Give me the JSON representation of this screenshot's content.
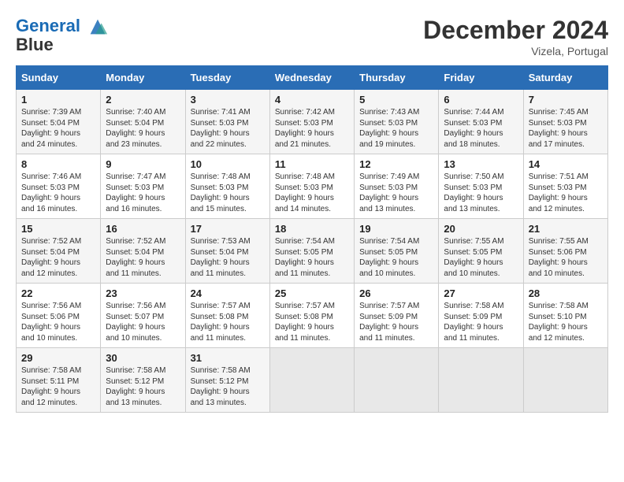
{
  "header": {
    "logo_line1": "General",
    "logo_line2": "Blue",
    "month_title": "December 2024",
    "location": "Vizela, Portugal"
  },
  "weekdays": [
    "Sunday",
    "Monday",
    "Tuesday",
    "Wednesday",
    "Thursday",
    "Friday",
    "Saturday"
  ],
  "weeks": [
    [
      {
        "day": "1",
        "sunrise": "Sunrise: 7:39 AM",
        "sunset": "Sunset: 5:04 PM",
        "daylight": "Daylight: 9 hours and 24 minutes."
      },
      {
        "day": "2",
        "sunrise": "Sunrise: 7:40 AM",
        "sunset": "Sunset: 5:04 PM",
        "daylight": "Daylight: 9 hours and 23 minutes."
      },
      {
        "day": "3",
        "sunrise": "Sunrise: 7:41 AM",
        "sunset": "Sunset: 5:03 PM",
        "daylight": "Daylight: 9 hours and 22 minutes."
      },
      {
        "day": "4",
        "sunrise": "Sunrise: 7:42 AM",
        "sunset": "Sunset: 5:03 PM",
        "daylight": "Daylight: 9 hours and 21 minutes."
      },
      {
        "day": "5",
        "sunrise": "Sunrise: 7:43 AM",
        "sunset": "Sunset: 5:03 PM",
        "daylight": "Daylight: 9 hours and 19 minutes."
      },
      {
        "day": "6",
        "sunrise": "Sunrise: 7:44 AM",
        "sunset": "Sunset: 5:03 PM",
        "daylight": "Daylight: 9 hours and 18 minutes."
      },
      {
        "day": "7",
        "sunrise": "Sunrise: 7:45 AM",
        "sunset": "Sunset: 5:03 PM",
        "daylight": "Daylight: 9 hours and 17 minutes."
      }
    ],
    [
      {
        "day": "8",
        "sunrise": "Sunrise: 7:46 AM",
        "sunset": "Sunset: 5:03 PM",
        "daylight": "Daylight: 9 hours and 16 minutes."
      },
      {
        "day": "9",
        "sunrise": "Sunrise: 7:47 AM",
        "sunset": "Sunset: 5:03 PM",
        "daylight": "Daylight: 9 hours and 16 minutes."
      },
      {
        "day": "10",
        "sunrise": "Sunrise: 7:48 AM",
        "sunset": "Sunset: 5:03 PM",
        "daylight": "Daylight: 9 hours and 15 minutes."
      },
      {
        "day": "11",
        "sunrise": "Sunrise: 7:48 AM",
        "sunset": "Sunset: 5:03 PM",
        "daylight": "Daylight: 9 hours and 14 minutes."
      },
      {
        "day": "12",
        "sunrise": "Sunrise: 7:49 AM",
        "sunset": "Sunset: 5:03 PM",
        "daylight": "Daylight: 9 hours and 13 minutes."
      },
      {
        "day": "13",
        "sunrise": "Sunrise: 7:50 AM",
        "sunset": "Sunset: 5:03 PM",
        "daylight": "Daylight: 9 hours and 13 minutes."
      },
      {
        "day": "14",
        "sunrise": "Sunrise: 7:51 AM",
        "sunset": "Sunset: 5:03 PM",
        "daylight": "Daylight: 9 hours and 12 minutes."
      }
    ],
    [
      {
        "day": "15",
        "sunrise": "Sunrise: 7:52 AM",
        "sunset": "Sunset: 5:04 PM",
        "daylight": "Daylight: 9 hours and 12 minutes."
      },
      {
        "day": "16",
        "sunrise": "Sunrise: 7:52 AM",
        "sunset": "Sunset: 5:04 PM",
        "daylight": "Daylight: 9 hours and 11 minutes."
      },
      {
        "day": "17",
        "sunrise": "Sunrise: 7:53 AM",
        "sunset": "Sunset: 5:04 PM",
        "daylight": "Daylight: 9 hours and 11 minutes."
      },
      {
        "day": "18",
        "sunrise": "Sunrise: 7:54 AM",
        "sunset": "Sunset: 5:05 PM",
        "daylight": "Daylight: 9 hours and 11 minutes."
      },
      {
        "day": "19",
        "sunrise": "Sunrise: 7:54 AM",
        "sunset": "Sunset: 5:05 PM",
        "daylight": "Daylight: 9 hours and 10 minutes."
      },
      {
        "day": "20",
        "sunrise": "Sunrise: 7:55 AM",
        "sunset": "Sunset: 5:05 PM",
        "daylight": "Daylight: 9 hours and 10 minutes."
      },
      {
        "day": "21",
        "sunrise": "Sunrise: 7:55 AM",
        "sunset": "Sunset: 5:06 PM",
        "daylight": "Daylight: 9 hours and 10 minutes."
      }
    ],
    [
      {
        "day": "22",
        "sunrise": "Sunrise: 7:56 AM",
        "sunset": "Sunset: 5:06 PM",
        "daylight": "Daylight: 9 hours and 10 minutes."
      },
      {
        "day": "23",
        "sunrise": "Sunrise: 7:56 AM",
        "sunset": "Sunset: 5:07 PM",
        "daylight": "Daylight: 9 hours and 10 minutes."
      },
      {
        "day": "24",
        "sunrise": "Sunrise: 7:57 AM",
        "sunset": "Sunset: 5:08 PM",
        "daylight": "Daylight: 9 hours and 11 minutes."
      },
      {
        "day": "25",
        "sunrise": "Sunrise: 7:57 AM",
        "sunset": "Sunset: 5:08 PM",
        "daylight": "Daylight: 9 hours and 11 minutes."
      },
      {
        "day": "26",
        "sunrise": "Sunrise: 7:57 AM",
        "sunset": "Sunset: 5:09 PM",
        "daylight": "Daylight: 9 hours and 11 minutes."
      },
      {
        "day": "27",
        "sunrise": "Sunrise: 7:58 AM",
        "sunset": "Sunset: 5:09 PM",
        "daylight": "Daylight: 9 hours and 11 minutes."
      },
      {
        "day": "28",
        "sunrise": "Sunrise: 7:58 AM",
        "sunset": "Sunset: 5:10 PM",
        "daylight": "Daylight: 9 hours and 12 minutes."
      }
    ],
    [
      {
        "day": "29",
        "sunrise": "Sunrise: 7:58 AM",
        "sunset": "Sunset: 5:11 PM",
        "daylight": "Daylight: 9 hours and 12 minutes."
      },
      {
        "day": "30",
        "sunrise": "Sunrise: 7:58 AM",
        "sunset": "Sunset: 5:12 PM",
        "daylight": "Daylight: 9 hours and 13 minutes."
      },
      {
        "day": "31",
        "sunrise": "Sunrise: 7:58 AM",
        "sunset": "Sunset: 5:12 PM",
        "daylight": "Daylight: 9 hours and 13 minutes."
      },
      null,
      null,
      null,
      null
    ]
  ]
}
